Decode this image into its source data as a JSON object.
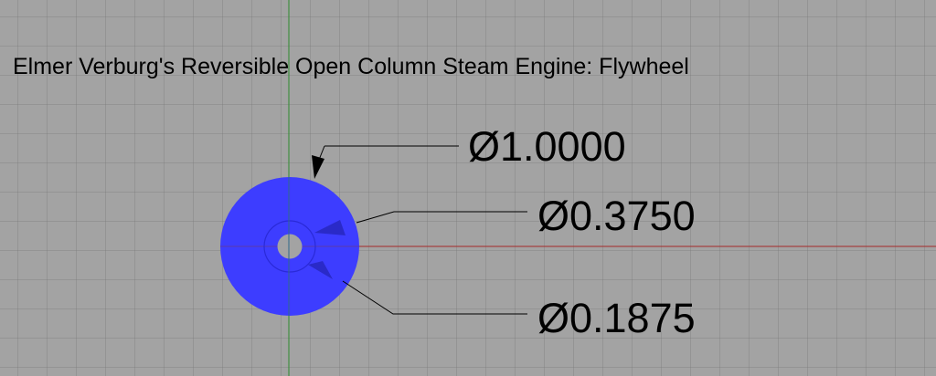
{
  "drawing": {
    "title": "Elmer Verburg's Reversible Open Column Steam Engine: Flywheel",
    "dimensions": [
      {
        "label": "Ø1.0000",
        "feature": "outer-diameter"
      },
      {
        "label": "Ø0.3750",
        "feature": "hub-diameter"
      },
      {
        "label": "Ø0.1875",
        "feature": "bore-diameter"
      }
    ],
    "colors": {
      "background": "#a3a3a3",
      "part_fill": "#3d3dff",
      "x_axis": "#a52a2a",
      "y_axis": "#2e8b2e",
      "leader": "#000000"
    }
  }
}
